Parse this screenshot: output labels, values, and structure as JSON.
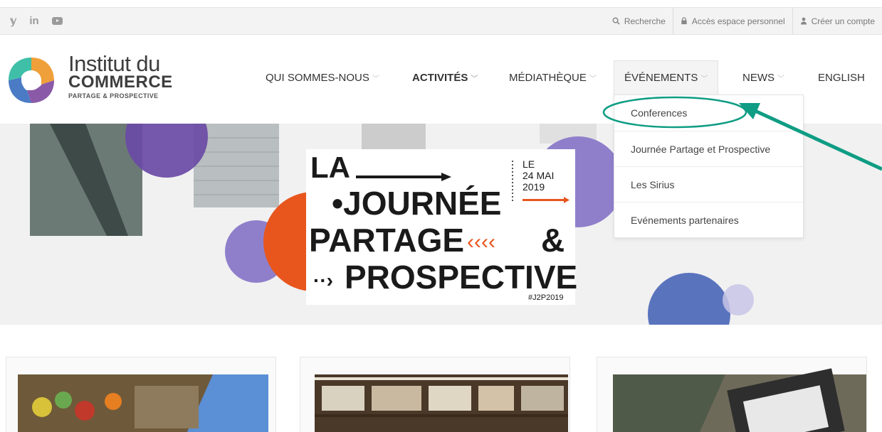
{
  "topbar": {
    "social": [
      "twitter-icon",
      "linkedin-icon",
      "youtube-icon"
    ],
    "search_label": "Recherche",
    "personal_space_label": "Accès espace personnel",
    "create_account_label": "Créer un compte"
  },
  "logo": {
    "line1": "Institut du",
    "line2": "COMMERCE",
    "line3": "PARTAGE & PROSPECTIVE"
  },
  "nav": {
    "items": [
      {
        "label": "QUI SOMMES-NOUS"
      },
      {
        "label": "ACTIVITÉS"
      },
      {
        "label": "MÉDIATHÈQUE"
      },
      {
        "label": "ÉVÉNEMENTS"
      },
      {
        "label": "NEWS"
      },
      {
        "label": "ENGLISH"
      }
    ]
  },
  "dropdown": {
    "items": [
      {
        "label": "Conferences"
      },
      {
        "label": "Journée Partage et Prospective"
      },
      {
        "label": "Les Sirius"
      },
      {
        "label": "Evénements partenaires"
      }
    ]
  },
  "hero": {
    "la": "LA",
    "journee": "•JOURNÉE",
    "partage": "PARTAGE",
    "amp": "&",
    "prospective": "PROSPECTIVE",
    "date_le": "LE",
    "date_day": "24 MAI",
    "date_year": "2019",
    "hashtag": "#J2P2019"
  },
  "colors": {
    "annotation": "#0f9d84",
    "purple": "#8a7cc9",
    "orange": "#e8561e",
    "blue": "#5a73bd"
  }
}
